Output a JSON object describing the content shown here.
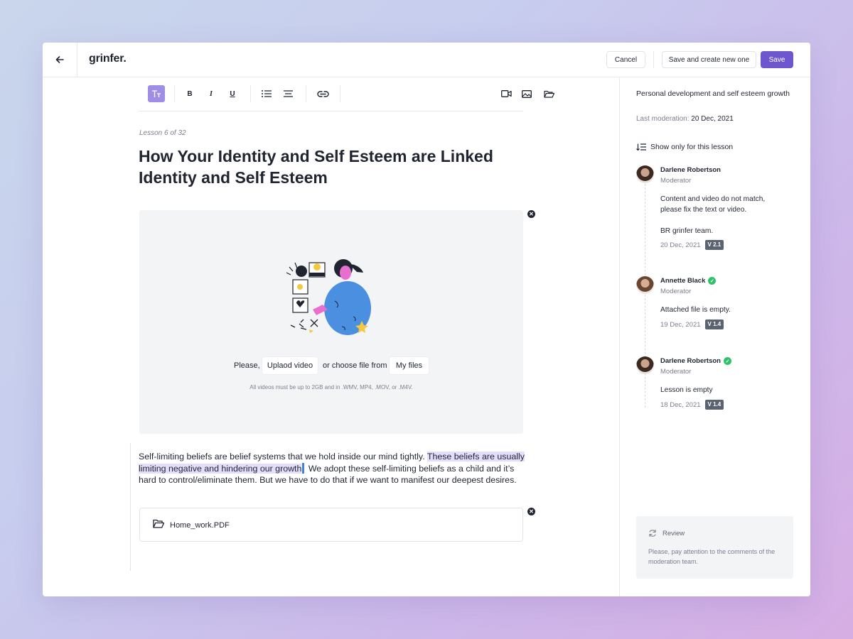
{
  "app": {
    "logo": "grinfer."
  },
  "header": {
    "cancel_label": "Cancel",
    "save_create_label": "Save and create new one",
    "save_label": "Save"
  },
  "toolbar": {
    "items": [
      "text-style-icon",
      "bold-icon",
      "italic-icon",
      "underline-icon",
      "list-icon",
      "align-icon",
      "link-icon",
      "video-icon",
      "image-icon",
      "folder-icon"
    ],
    "bold": "B",
    "italic": "I",
    "underline": "U"
  },
  "lesson": {
    "meta": "Lesson 6 of 32",
    "title": "How Your Identity and Self Esteem are Linked Identity and Self Esteem"
  },
  "video": {
    "please": "Please,",
    "upload_label": "Uplaod video",
    "choose_text": "or choose file from",
    "my_files_label": "My files",
    "note": "All videos must be up to 2GB and in .WMV, MP4, .MOV, or .M4V."
  },
  "body": {
    "part1": "Self-limiting beliefs are belief systems that we hold inside our mind tightly. ",
    "highlight": "These beliefs are usually limiting negative and hindering our growth",
    "part2": " We adopt these self-limiting beliefs as a child and it’s hard to control/eliminate them. But we have to do that if we want to manifest our deepest desires."
  },
  "attachment": {
    "file_name": "Home_work.PDF"
  },
  "sidebar": {
    "course_title": "Personal development and self esteem growth",
    "last_moderation_label": "Last moderation: ",
    "last_moderation_date": "20 Dec, 2021",
    "filter_label": "Show only for this lesson",
    "comments": [
      {
        "name": "Darlene Robertson",
        "role": "Moderator",
        "message": "Content and video do not match, please fix the text or video.",
        "message2": "BR grinfer team.",
        "date": "20 Dec, 2021",
        "version": "V 2.1"
      },
      {
        "name": "Annette Black",
        "role": "Moderator",
        "message": "Attached file is empty.",
        "date": "19 Dec, 2021",
        "version": "V 1.4"
      },
      {
        "name": "Darlene Robertson",
        "role": "Moderator",
        "message": "Lesson is empty",
        "date": "18 Dec, 2021",
        "version": "V 1.4"
      }
    ],
    "review": {
      "title": "Review",
      "text": "Please, pay attention to the comments of the moderation team."
    }
  },
  "colors": {
    "accent": "#6e56cf",
    "active_tool": "#a08ee6",
    "highlight": "#e4ddfb",
    "approved": "#2ec36a"
  }
}
